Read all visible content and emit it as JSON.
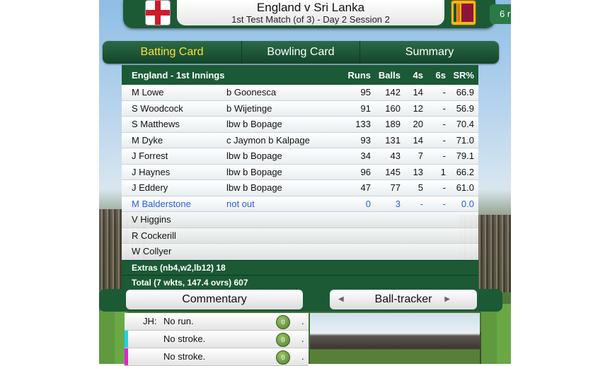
{
  "header": {
    "title": "England v Sri Lanka",
    "subtitle": "1st Test Match (of 3) - Day 2 Session 2",
    "score_peek": "6 r"
  },
  "tabs": [
    {
      "label": "Batting Card",
      "active": true
    },
    {
      "label": "Bowling Card",
      "active": false
    },
    {
      "label": "Summary",
      "active": false
    }
  ],
  "scorecard": {
    "innings_title": "England - 1st Innings",
    "columns": [
      "Runs",
      "Balls",
      "4s",
      "6s",
      "SR%"
    ],
    "rows": [
      {
        "name": "M Lowe",
        "how_out": "b Goonesca",
        "runs": "95",
        "balls": "142",
        "fours": "14",
        "sixes": "-",
        "sr": "66.9"
      },
      {
        "name": "S Woodcock",
        "how_out": "b Wijetinge",
        "runs": "91",
        "balls": "160",
        "fours": "12",
        "sixes": "-",
        "sr": "56.9"
      },
      {
        "name": "S Matthews",
        "how_out": "lbw b Bopage",
        "runs": "133",
        "balls": "189",
        "fours": "20",
        "sixes": "-",
        "sr": "70.4"
      },
      {
        "name": "M Dyke",
        "how_out": "c Jaymon b Kalpage",
        "runs": "93",
        "balls": "131",
        "fours": "14",
        "sixes": "-",
        "sr": "71.0"
      },
      {
        "name": "J Forrest",
        "how_out": "lbw b Bopage",
        "runs": "34",
        "balls": "43",
        "fours": "7",
        "sixes": "-",
        "sr": "79.1"
      },
      {
        "name": "J Haynes",
        "how_out": "lbw b Bopage",
        "runs": "96",
        "balls": "145",
        "fours": "13",
        "sixes": "1",
        "sr": "66.2"
      },
      {
        "name": "J Eddery",
        "how_out": "lbw b Bopage",
        "runs": "47",
        "balls": "77",
        "fours": "5",
        "sixes": "-",
        "sr": "61.0"
      },
      {
        "name": "M Balderstone",
        "how_out": "not out",
        "runs": "0",
        "balls": "3",
        "fours": "-",
        "sixes": "-",
        "sr": "0.0"
      },
      {
        "name": "V Higgins",
        "how_out": "",
        "runs": "",
        "balls": "",
        "fours": "",
        "sixes": "",
        "sr": ""
      },
      {
        "name": "R Cockerill",
        "how_out": "",
        "runs": "",
        "balls": "",
        "fours": "",
        "sixes": "",
        "sr": ""
      },
      {
        "name": "W Collyer",
        "how_out": "",
        "runs": "",
        "balls": "",
        "fours": "",
        "sixes": "",
        "sr": ""
      }
    ],
    "extras": "Extras (nb4,w2,lb12) 18",
    "total": "Total (7 wkts, 147.4 ovrs) 607"
  },
  "bottom": {
    "commentary_label": "Commentary",
    "tracker_label": "Ball-tracker",
    "prev_icon": "◀",
    "next_icon": "▶"
  },
  "commentary": [
    {
      "who": "JH:",
      "text": "No run.",
      "ball": "0",
      "dot": ".",
      "bar": ""
    },
    {
      "who": "",
      "text": "No stroke.",
      "ball": "0",
      "dot": ".",
      "bar": "#19d6e8"
    },
    {
      "who": "",
      "text": "No stroke.",
      "ball": "0",
      "dot": ".",
      "bar": "#e81fd6"
    }
  ],
  "colors": {
    "accent_green": "#1b5a35",
    "active_tab": "#ffe033",
    "not_out_blue": "#2c5fd9"
  }
}
